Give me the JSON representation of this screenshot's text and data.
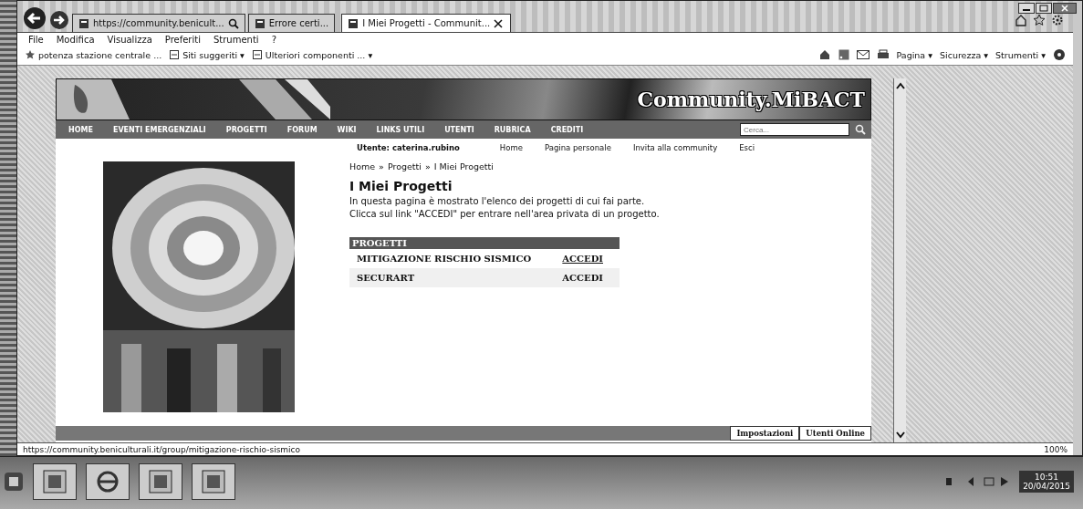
{
  "browser": {
    "tabs": [
      {
        "label": "https://community.benicult...",
        "selected": false
      },
      {
        "label": "Errore certi...",
        "selected": false
      },
      {
        "label": "I Miei Progetti - Communit...",
        "selected": true
      }
    ],
    "menu": [
      "File",
      "Modifica",
      "Visualizza",
      "Preferiti",
      "Strumenti",
      "?"
    ],
    "favorites": [
      "potenza stazione centrale ...",
      "Siti suggeriti ▾",
      "Ulteriori componenti ... ▾"
    ],
    "commands": [
      "Pagina ▾",
      "Sicurezza ▾",
      "Strumenti ▾"
    ]
  },
  "site": {
    "logo": "Community.MiBACT",
    "nav": [
      "HOME",
      "EVENTI EMERGENZIALI",
      "PROGETTI",
      "FORUM",
      "WIKI",
      "LINKS UTILI",
      "UTENTI",
      "RUBRICA",
      "CREDITI"
    ],
    "search": {
      "placeholder": "Cerca..."
    },
    "user": "Utente: caterina.rubino",
    "user_links": [
      "Home",
      "Pagina personale",
      "Invita alla community",
      "Esci"
    ],
    "breadcrumb": {
      "items": [
        "Home",
        "Progetti",
        "I Miei Progetti"
      ],
      "separator": "»"
    },
    "title": "I Miei Progetti",
    "description": [
      "In questa pagina è mostrato l'elenco dei progetti di cui fai parte.",
      "Clicca sul link \"ACCEDI\" per entrare nell'area privata di un progetto."
    ],
    "table": {
      "header": "PROGETTI",
      "rows": [
        {
          "name": "MITIGAZIONE RISCHIO SISMICO",
          "action": "ACCEDI"
        },
        {
          "name": "SECURART",
          "action": "ACCEDI"
        }
      ]
    },
    "footer_buttons": [
      "Impostazioni",
      "Utenti Online"
    ]
  },
  "status_bar": {
    "url": "https://community.beniculturali.it/group/mitigazione-rischio-sismico",
    "zoom": "100%"
  },
  "taskbar": {
    "time": "10:51",
    "date": "20/04/2015"
  }
}
